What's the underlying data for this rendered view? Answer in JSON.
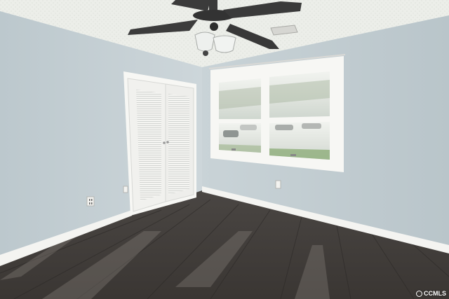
{
  "watermark": {
    "text": "CCMLS"
  },
  "colors": {
    "wall": "#c7d2d6",
    "wall_shadow": "#b7c4c9",
    "ceiling": "#e9ebe7",
    "trim": "#f5f5f2",
    "floor_dark": "#3d3a38",
    "floor_light": "#6e6a66",
    "fan_body": "#3a3a3a",
    "window_outside": "#dfe6e2"
  },
  "scene": {
    "description_icons": [
      "ceiling-fan-icon",
      "closet-door-icon",
      "window-icon",
      "outlet-icon"
    ]
  }
}
